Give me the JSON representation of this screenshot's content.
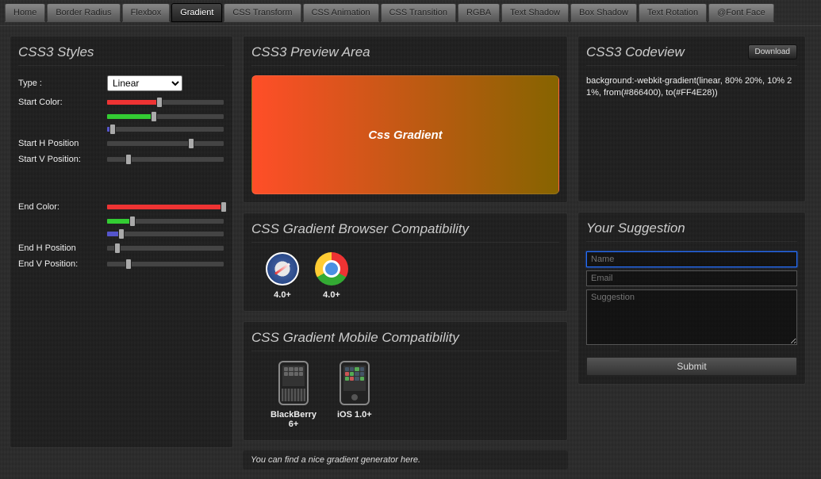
{
  "nav": {
    "tabs": [
      {
        "label": "Home"
      },
      {
        "label": "Border Radius"
      },
      {
        "label": "Flexbox"
      },
      {
        "label": "Gradient",
        "active": true
      },
      {
        "label": "CSS Transform"
      },
      {
        "label": "CSS Animation"
      },
      {
        "label": "CSS Transition"
      },
      {
        "label": "RGBA"
      },
      {
        "label": "Text Shadow"
      },
      {
        "label": "Box Shadow"
      },
      {
        "label": "Text Rotation"
      },
      {
        "label": "@Font Face"
      }
    ]
  },
  "styles": {
    "title": "CSS3 Styles",
    "type_label": "Type :",
    "type_value": "Linear",
    "rows": {
      "start_color": "Start Color:",
      "start_h": "Start H Position",
      "start_v": "Start V Position:",
      "end_color": "End Color:",
      "end_h": "End H Position",
      "end_v": "End V Position:"
    }
  },
  "preview": {
    "title": "CSS3 Preview Area",
    "label": "Css Gradient"
  },
  "browser_compat": {
    "title": "CSS Gradient Browser Compatibility",
    "items": [
      {
        "name": "safari",
        "label": "4.0+"
      },
      {
        "name": "chrome",
        "label": "4.0+"
      }
    ]
  },
  "mobile_compat": {
    "title": "CSS Gradient Mobile Compatibility",
    "items": [
      {
        "name": "blackberry",
        "label": "BlackBerry 6+"
      },
      {
        "name": "ios",
        "label": "iOS 1.0+"
      }
    ]
  },
  "footer": "You can find a nice gradient generator here.",
  "codeview": {
    "title": "CSS3 Codeview",
    "download": "Download",
    "code": "background:-webkit-gradient(linear, 80% 20%, 10% 21%, from(#866400), to(#FF4E28))"
  },
  "suggestion": {
    "title": "Your Suggestion",
    "name_ph": "Name",
    "email_ph": "Email",
    "text_ph": "Suggestion",
    "submit": "Submit"
  }
}
